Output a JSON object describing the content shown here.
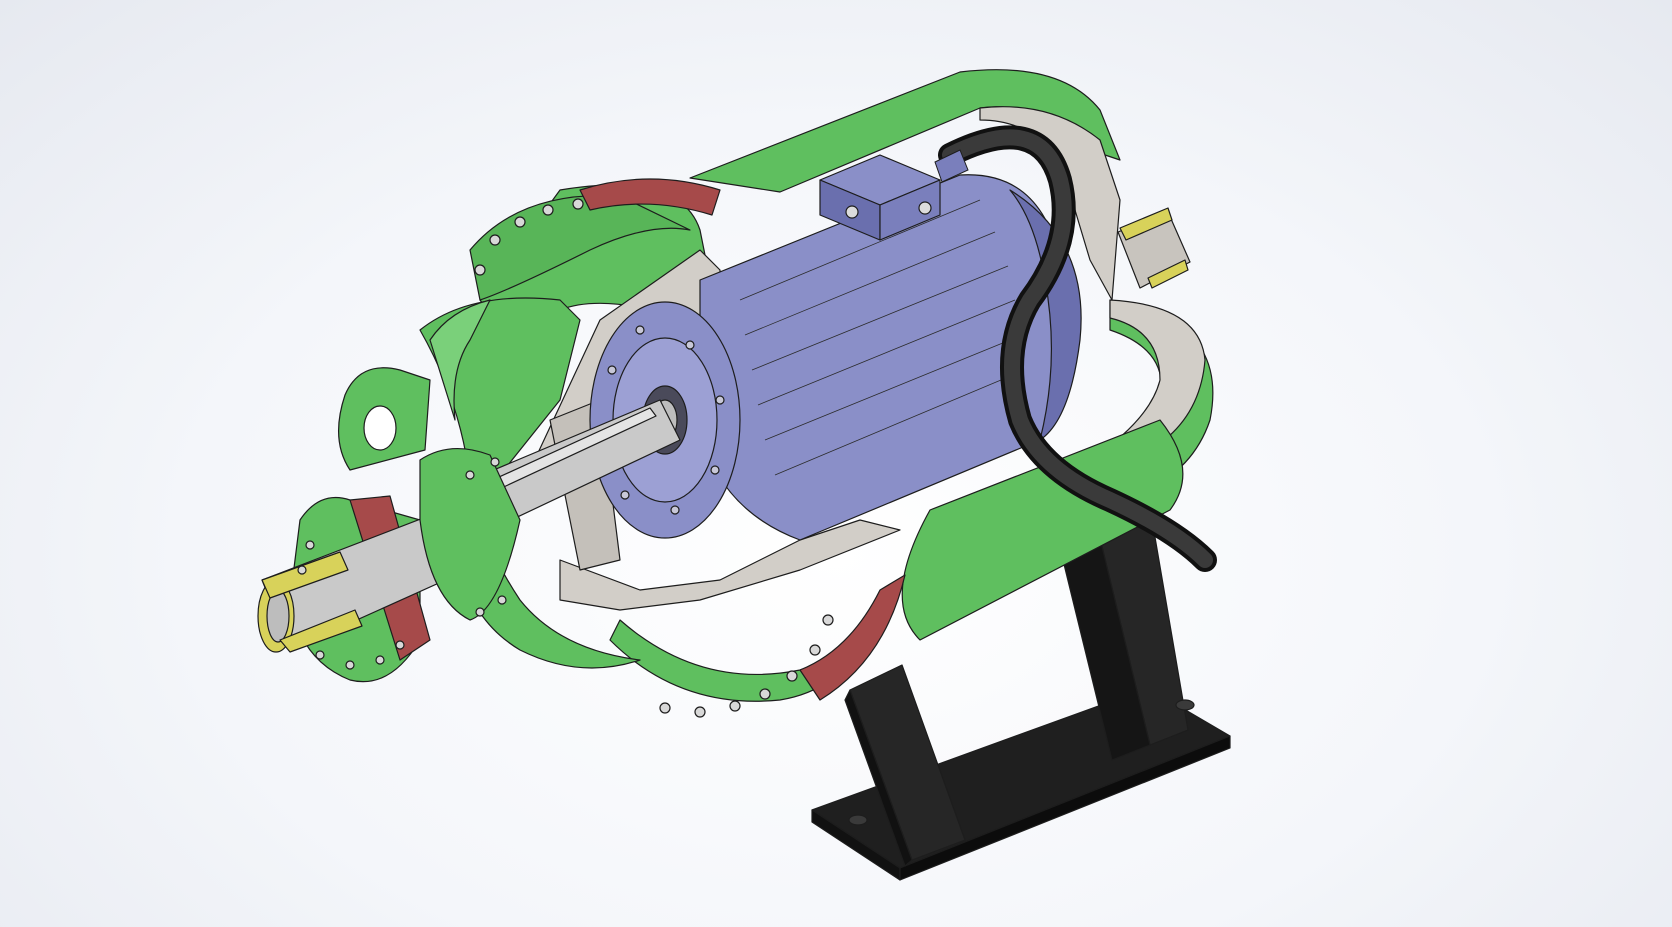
{
  "colors": {
    "background": "#eef0f5",
    "housing_green": "#5fbf5f",
    "housing_green_dark": "#3f9a3f",
    "gasket_red": "#a64a4a",
    "motor_blue": "#8a8fc8",
    "motor_blue_dark": "#6a6fae",
    "section_grey": "#d2cec8",
    "shaft_grey": "#c9c9c9",
    "pipe_yellow": "#d8d25a",
    "cable_black": "#222222",
    "stand_black": "#1c1c1c"
  },
  "icons": {
    "cable": "power-cable",
    "terminal_box": "terminal-box",
    "bolt": "bolt-head"
  }
}
